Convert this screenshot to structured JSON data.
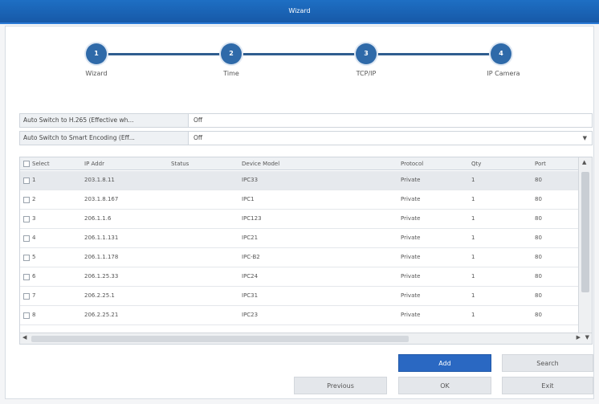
{
  "window": {
    "title": "Wizard"
  },
  "steps": [
    {
      "number": "1",
      "label": "Wizard"
    },
    {
      "number": "2",
      "label": "Time"
    },
    {
      "number": "3",
      "label": "TCP/IP"
    },
    {
      "number": "4",
      "label": "IP Camera"
    }
  ],
  "options": {
    "h265": {
      "label": "Auto Switch to H.265 (Effective wh...",
      "value": "Off"
    },
    "smart": {
      "label": "Auto Switch to Smart Encoding (Eff...",
      "value": "Off"
    }
  },
  "table": {
    "columns": [
      "Select",
      "IP Addr",
      "Status",
      "Device Model",
      "Protocol",
      "Qty",
      "Port"
    ],
    "rows": [
      {
        "idx": "1",
        "ip": "203.1.8.11",
        "status": "",
        "model": "IPC33",
        "protocol": "Private",
        "qty": "1",
        "port": "80"
      },
      {
        "idx": "2",
        "ip": "203.1.8.167",
        "status": "",
        "model": "IPC1",
        "protocol": "Private",
        "qty": "1",
        "port": "80"
      },
      {
        "idx": "3",
        "ip": "206.1.1.6",
        "status": "",
        "model": "IPC123",
        "protocol": "Private",
        "qty": "1",
        "port": "80"
      },
      {
        "idx": "4",
        "ip": "206.1.1.131",
        "status": "",
        "model": "IPC21",
        "protocol": "Private",
        "qty": "1",
        "port": "80"
      },
      {
        "idx": "5",
        "ip": "206.1.1.178",
        "status": "",
        "model": "IPC-B2",
        "protocol": "Private",
        "qty": "1",
        "port": "80"
      },
      {
        "idx": "6",
        "ip": "206.1.25.33",
        "status": "",
        "model": "IPC24",
        "protocol": "Private",
        "qty": "1",
        "port": "80"
      },
      {
        "idx": "7",
        "ip": "206.2.25.1",
        "status": "",
        "model": "IPC31",
        "protocol": "Private",
        "qty": "1",
        "port": "80"
      },
      {
        "idx": "8",
        "ip": "206.2.25.21",
        "status": "",
        "model": "IPC23",
        "protocol": "Private",
        "qty": "1",
        "port": "80"
      }
    ]
  },
  "buttons": {
    "add": "Add",
    "search": "Search",
    "previous": "Previous",
    "ok": "OK",
    "exit": "Exit"
  }
}
